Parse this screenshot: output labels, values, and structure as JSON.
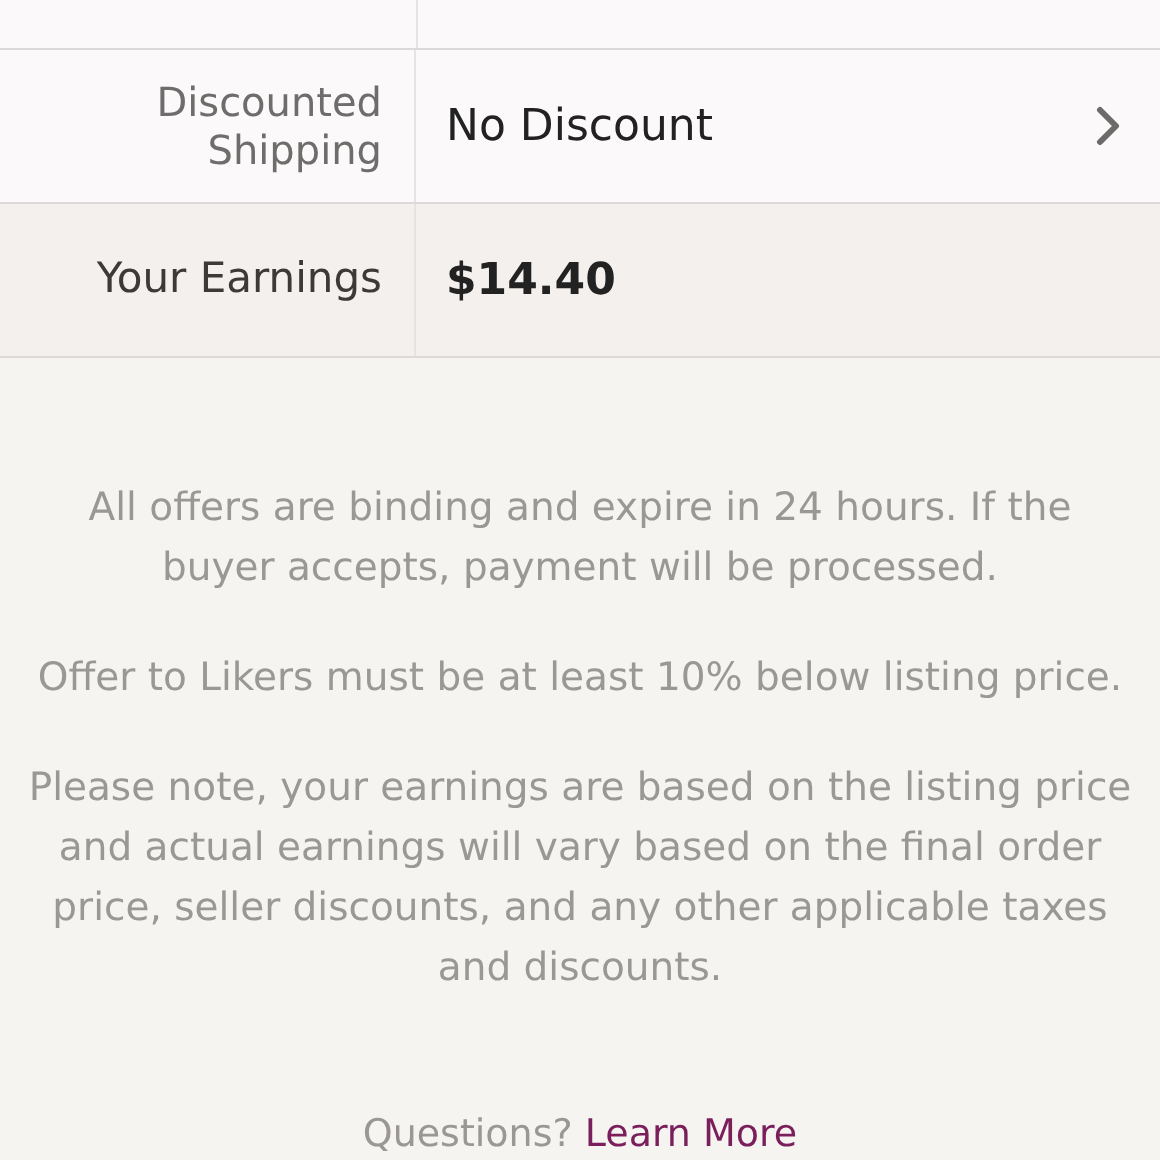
{
  "rows": [
    {
      "label": "Discounted Shipping",
      "value": "No Discount",
      "kind": "link"
    },
    {
      "label": "Your Earnings",
      "value": "$14.40",
      "kind": "total"
    }
  ],
  "notes": [
    "All offers are binding and expire in 24 hours. If the buyer accepts, payment will be processed.",
    "Offer to Likers must be at least 10% below listing price.",
    "Please note, your earnings are based on the listing price and actual earnings will vary based on the final order price, seller discounts, and any other applicable taxes and discounts."
  ],
  "footer": {
    "text": "Questions?",
    "link": "Learn More"
  }
}
